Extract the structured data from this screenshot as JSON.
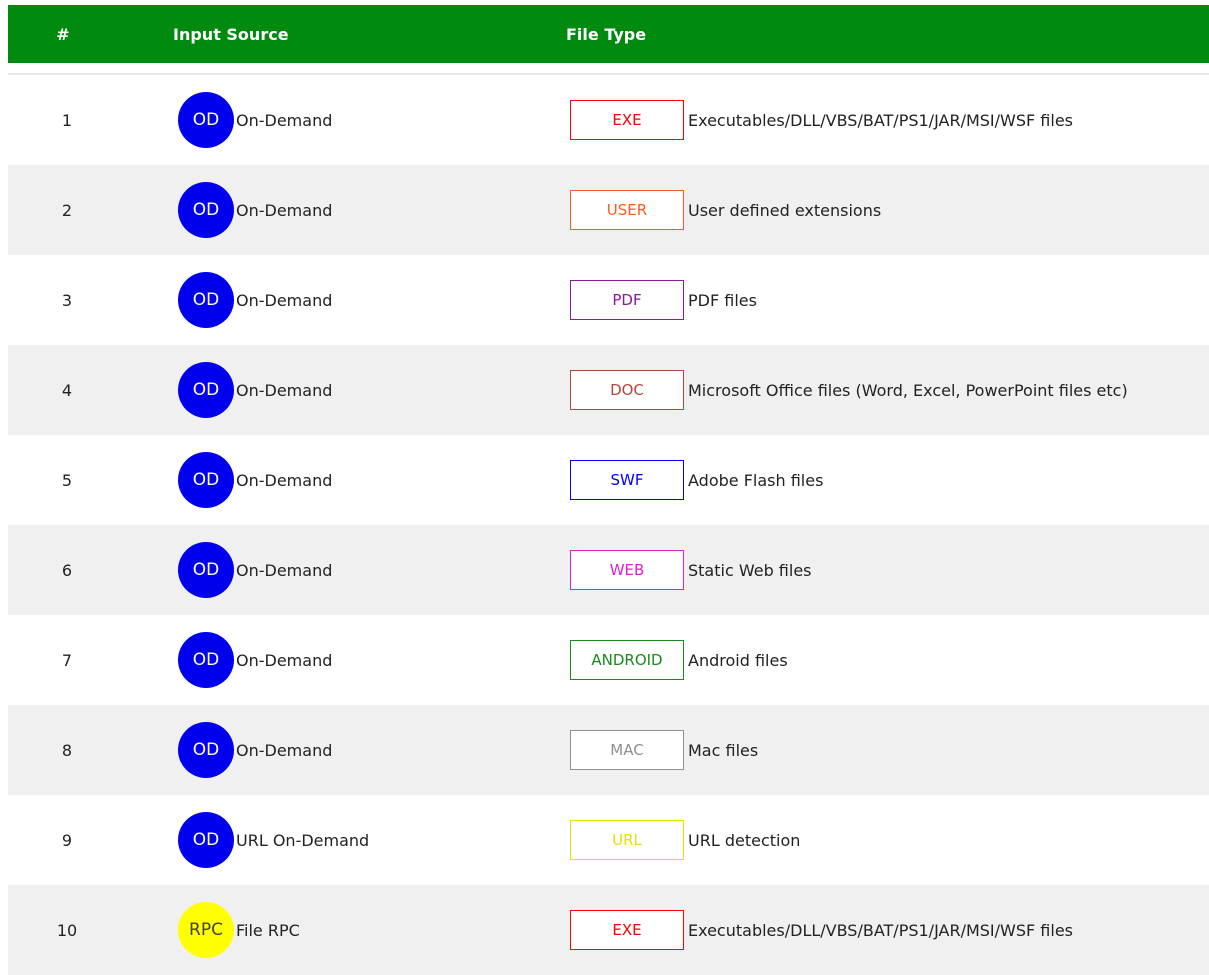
{
  "header": {
    "num": "#",
    "source": "Input Source",
    "type": "File Type"
  },
  "rows": [
    {
      "num": "1",
      "badge": "OD",
      "source": "On-Demand",
      "type": "EXE",
      "color": "#ff0000",
      "desc": "Executables/DLL/VBS/BAT/PS1/JAR/MSI/WSF files"
    },
    {
      "num": "2",
      "badge": "OD",
      "source": "On-Demand",
      "type": "USER",
      "color": "#ff5a1f",
      "desc": "User defined extensions"
    },
    {
      "num": "3",
      "badge": "OD",
      "source": "On-Demand",
      "type": "PDF",
      "color": "#8a1a9b",
      "desc": "PDF files"
    },
    {
      "num": "4",
      "badge": "OD",
      "source": "On-Demand",
      "type": "DOC",
      "color": "#b5463c",
      "desc": "Microsoft Office files (Word, Excel, PowerPoint files etc)"
    },
    {
      "num": "5",
      "badge": "OD",
      "source": "On-Demand",
      "type": "SWF",
      "color": "#0000ff",
      "desc": "Adobe Flash files"
    },
    {
      "num": "6",
      "badge": "OD",
      "source": "On-Demand",
      "type": "WEB",
      "color": "#e020c8",
      "desc": "Static Web files"
    },
    {
      "num": "7",
      "badge": "OD",
      "source": "On-Demand",
      "type": "ANDROID",
      "color": "#1a8a1a",
      "desc": "Android files"
    },
    {
      "num": "8",
      "badge": "OD",
      "source": "On-Demand",
      "type": "MAC",
      "color": "#909090",
      "desc": "Mac files"
    },
    {
      "num": "9",
      "badge": "OD",
      "source": "URL On-Demand",
      "type": "URL",
      "color": "#e8e000",
      "desc": "URL detection"
    },
    {
      "num": "10",
      "badge": "RPC",
      "source": "File RPC",
      "type": "EXE",
      "color": "#ff0000",
      "desc": "Executables/DLL/VBS/BAT/PS1/JAR/MSI/WSF files"
    }
  ],
  "colors": {
    "header_bg": "#008a0f",
    "od_badge": "#0000ee",
    "rpc_badge": "#ffff00",
    "alt_row": "#f0f0f0"
  }
}
